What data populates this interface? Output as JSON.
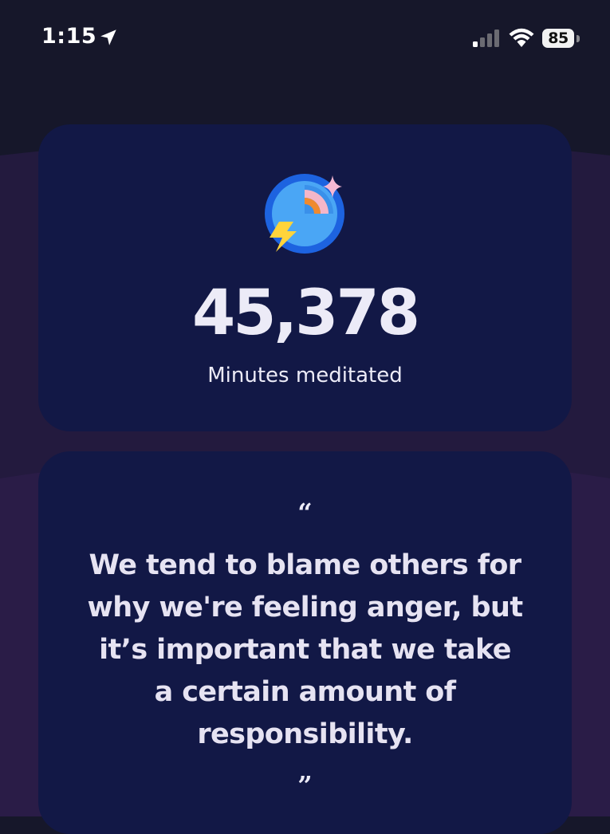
{
  "status_bar": {
    "time": "1:15",
    "battery": "85"
  },
  "stat": {
    "value": "45,378",
    "label": "Minutes meditated",
    "icon": "meditation-timer-icon"
  },
  "quote": {
    "open_mark": "“",
    "text": "We tend to blame others for why we're feeling anger, but it’s important that we take a certain amount of responsibility.",
    "close_mark": "”"
  },
  "colors": {
    "background": "#16172a",
    "wave": "#251a3f",
    "card": "#121846",
    "text": "#ecebf7"
  }
}
